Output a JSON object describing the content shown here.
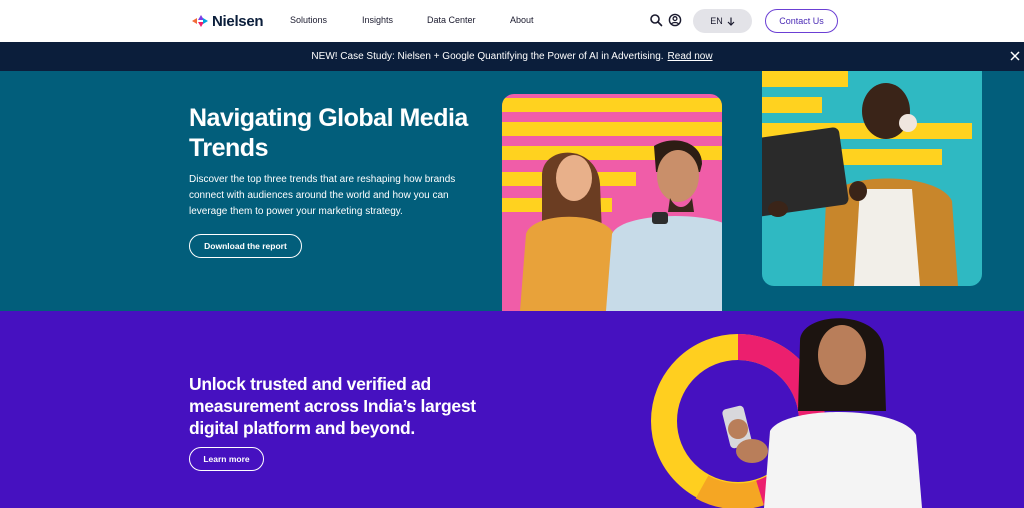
{
  "nav": {
    "logo_text": "Nielsen",
    "links": [
      "Solutions",
      "Insights",
      "Data Center",
      "About"
    ],
    "language": "EN",
    "contact_label": "Contact Us"
  },
  "banner": {
    "text": "NEW! Case Study: Nielsen + Google Quantifying the Power of AI in Advertising.",
    "link_label": "Read now"
  },
  "hero1": {
    "title": "Navigating Global Media Trends",
    "description": "Discover the top three trends that are reshaping how brands connect with audiences around the world and how you can leverage them to power your marketing strategy.",
    "button_label": "Download the report"
  },
  "hero2": {
    "title": "Unlock trusted and verified ad measurement across India’s largest digital platform and beyond.",
    "button_label": "Learn more"
  },
  "colors": {
    "hero1_bg": "#025e7b",
    "hero2_bg": "#4611c0",
    "banner_bg": "#0b1e3b",
    "accent_purple": "#6b3fd4"
  }
}
